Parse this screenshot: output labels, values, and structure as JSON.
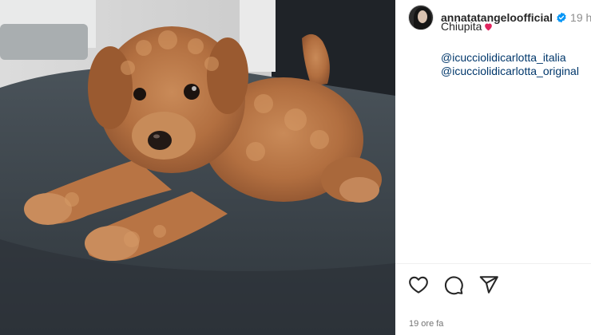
{
  "post": {
    "username": "annatatangeloofficial",
    "time_short": "19 h",
    "caption": "Chiupita",
    "mentions": [
      "@icucciolidicarlotta_italia",
      "@icucciolidicarlotta_original"
    ],
    "time_ago": "19 ore fa"
  },
  "icons": {
    "verified": "verified-badge-icon",
    "caption_emoji": "heart-emoji-icon",
    "like": "heart-icon",
    "comment": "comment-icon",
    "share": "paper-plane-icon"
  },
  "colors": {
    "link": "#00376b",
    "verified": "#0095f6",
    "emoji_heart": "#e0245e",
    "secondary_text": "#737373"
  }
}
